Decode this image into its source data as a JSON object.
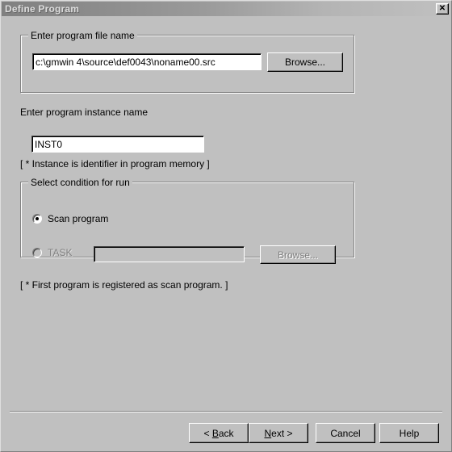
{
  "window": {
    "title": "Define Program",
    "close_icon": "close-icon",
    "close_glyph": "✕"
  },
  "file_group": {
    "legend": "Enter program file name",
    "path_value": "c:\\gmwin 4\\source\\def0043\\noname00.src",
    "path_placeholder": "",
    "browse_label": "Browse..."
  },
  "instance": {
    "label": "Enter program instance name",
    "value": "INST0",
    "placeholder": "",
    "note": "[ * Instance is identifier in program memory ]"
  },
  "condition_group": {
    "legend": "Select condition for run",
    "scan_label": "Scan program",
    "scan_selected": true,
    "task_label": "TASK",
    "task_selected": false,
    "task_enabled": false,
    "task_value": "",
    "task_placeholder": "",
    "task_browse_label": "Browse...",
    "note": "[ * First program is registered as scan program. ]"
  },
  "footer": {
    "back": {
      "prefix": "< ",
      "accel": "B",
      "suffix": "ack"
    },
    "next": {
      "prefix": "",
      "accel": "N",
      "suffix": "ext >"
    },
    "cancel_label": "Cancel",
    "help_label": "Help"
  },
  "colors": {
    "face": "#c0c0c0",
    "window": "#ffffff",
    "shadow": "#808080",
    "highlight": "#ffffff",
    "text": "#000000",
    "disabled_text": "#808080",
    "titlebar_start": "#808080",
    "titlebar_end": "#c0c0c0",
    "titlebar_text": "#dcdcdc"
  }
}
